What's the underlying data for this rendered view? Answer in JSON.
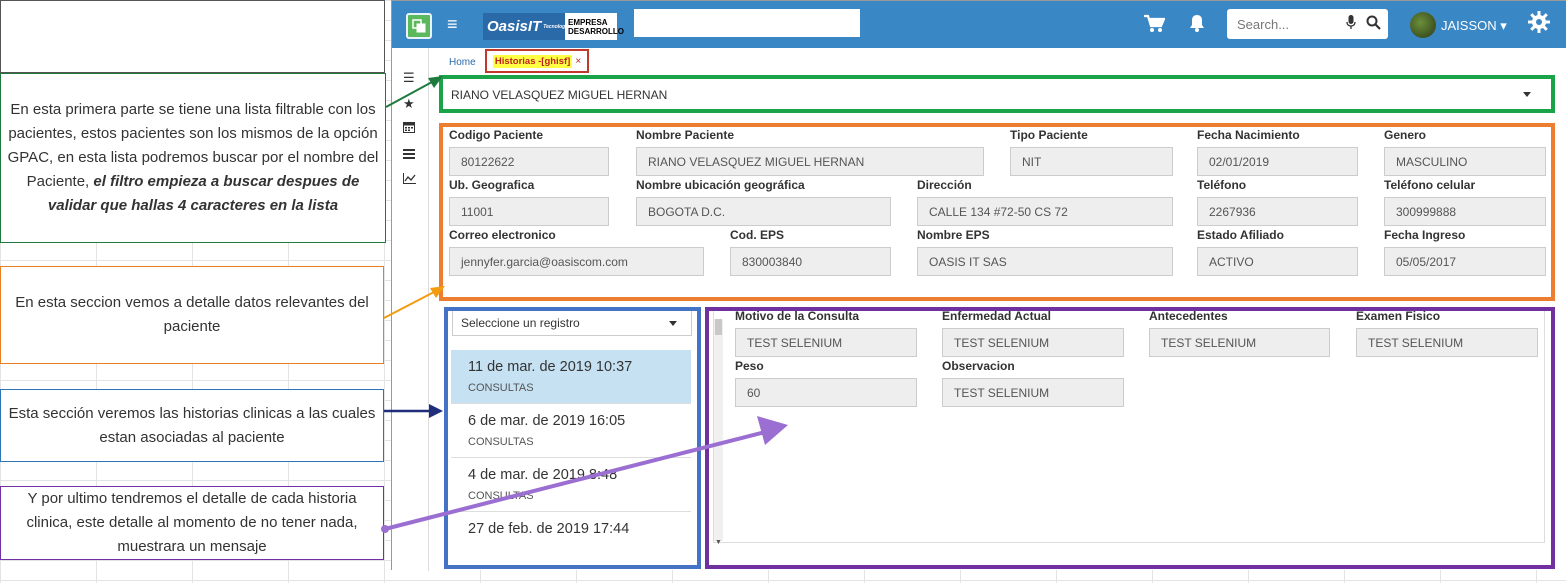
{
  "callouts": {
    "top_blank": "",
    "patients": {
      "text": "En esta primera parte se tiene una lista filtrable con los pacientes, estos pacientes son los mismos de la opción GPAC, en esta lista podremos buscar por el nombre del Paciente, ",
      "emphasis": "el filtro empieza a buscar despues de validar que hallas 4 caracteres en la lista"
    },
    "details": "En esta seccion vemos a detalle datos relevantes del paciente",
    "histories": "Esta sección veremos las historias clinicas a las cuales estan asociadas al paciente",
    "history_detail": "Y por ultimo tendremos el detalle de cada historia clinica, este detalle al momento de no tener nada, muestrara un mensaje"
  },
  "topbar": {
    "logo_brand": "OasisIT",
    "logo_tagline": "Tecnología",
    "logo_sub_line1": "EMPRESA",
    "logo_sub_line2": "DESARROLLO",
    "search_placeholder": "Search...",
    "user_name": "JAISSON",
    "icons": [
      "menu-icon",
      "cart-icon",
      "bell-icon",
      "microphone-icon",
      "search-icon",
      "settings-gear-icon"
    ]
  },
  "breadcrumb": {
    "home": "Home",
    "tab_label": "Historias -[ghisf]",
    "tab_close": "×"
  },
  "sidebar_icons": [
    "hamburger-icon",
    "star-icon",
    "calendar-icon",
    "list-icon",
    "chart-line-icon"
  ],
  "patient_select": {
    "value": "RIANO VELASQUEZ MIGUEL HERNAN"
  },
  "patient_fields": [
    {
      "label": "Codigo Paciente",
      "value": "80122622"
    },
    {
      "label": "Nombre Paciente",
      "value": "RIANO VELASQUEZ MIGUEL HERNAN"
    },
    {
      "label": "Tipo Paciente",
      "value": "NIT"
    },
    {
      "label": "Fecha Nacimiento",
      "value": "02/01/2019"
    },
    {
      "label": "Genero",
      "value": "MASCULINO"
    },
    {
      "label": "Ub. Geografica",
      "value": "11001"
    },
    {
      "label": "Nombre ubicación geográfica",
      "value": "BOGOTA D.C."
    },
    {
      "label": "Dirección",
      "value": "CALLE 134 #72-50 CS 72"
    },
    {
      "label": "Teléfono",
      "value": "2267936"
    },
    {
      "label": "Teléfono celular",
      "value": "300999888"
    },
    {
      "label": "Correo electronico",
      "value": "jennyfer.garcia@oasiscom.com"
    },
    {
      "label": "Cod. EPS",
      "value": "830003840"
    },
    {
      "label": "Nombre EPS",
      "value": "OASIS IT SAS"
    },
    {
      "label": "Estado Afiliado",
      "value": "ACTIVO"
    },
    {
      "label": "Fecha Ingreso",
      "value": "05/05/2017"
    }
  ],
  "history_list": {
    "select_placeholder": "Seleccione un registro",
    "items": [
      {
        "date": "11 de mar. de 2019 10:37",
        "type": "CONSULTAS",
        "selected": true
      },
      {
        "date": "6 de mar. de 2019 16:05",
        "type": "CONSULTAS",
        "selected": false
      },
      {
        "date": "4 de mar. de 2019 8:48",
        "type": "CONSULTAS",
        "selected": false
      },
      {
        "date": "27 de feb. de 2019 17:44",
        "type": "",
        "selected": false
      }
    ]
  },
  "history_detail": [
    {
      "label": "Motivo de la Consulta",
      "value": "TEST SELENIUM"
    },
    {
      "label": "Enfermedad Actual",
      "value": "TEST SELENIUM"
    },
    {
      "label": "Antecedentes",
      "value": "TEST SELENIUM"
    },
    {
      "label": "Examen Fisico",
      "value": "TEST SELENIUM"
    },
    {
      "label": "Peso",
      "value": "60"
    },
    {
      "label": "Observacion",
      "value": "TEST SELENIUM"
    }
  ],
  "colors": {
    "topbar": "#3a87c6",
    "green_region": "#1aa349",
    "orange_region": "#ed7d31",
    "blue_region": "#4472c4",
    "purple_region": "#7030a0",
    "selected_row": "#c5e1f2",
    "tab_highlight": "#ffff44"
  }
}
